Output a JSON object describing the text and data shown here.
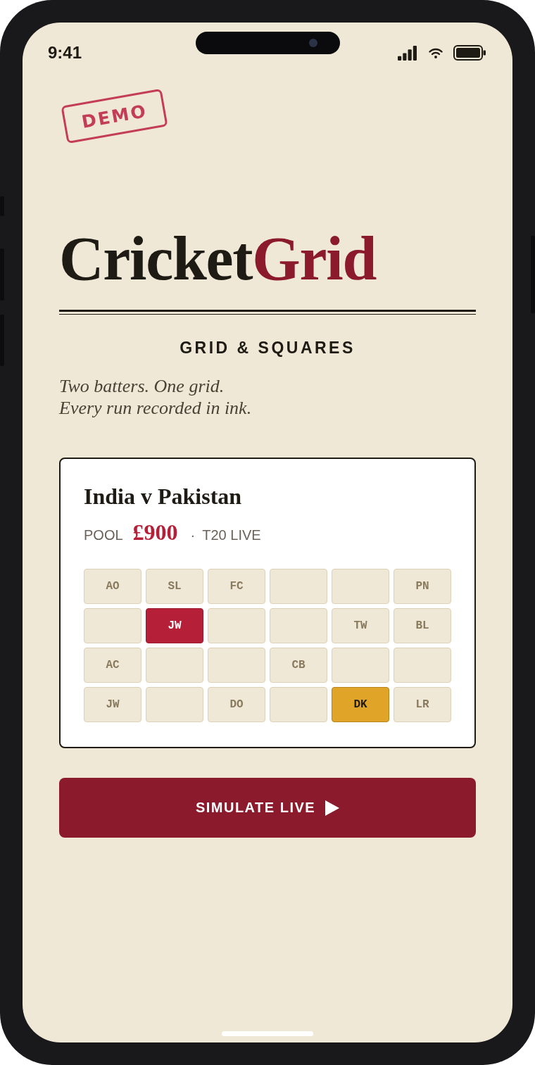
{
  "status_bar": {
    "time": "9:41"
  },
  "stamp": {
    "label": "DEMO"
  },
  "logo": [
    {
      "text": "Cricket",
      "accent": false
    },
    {
      "text": "Grid",
      "accent": true
    }
  ],
  "section_heading": "GRID & SQUARES",
  "tagline": [
    "Two batters. One grid.",
    "Every run recorded in ink."
  ],
  "match_card": {
    "title": "India v Pakistan",
    "pool_label": "POOL",
    "pool_amount": "£900",
    "separator": "·",
    "format": "T20 LIVE",
    "squares": [
      [
        {
          "initials": "AO",
          "selected": false,
          "leading": false
        },
        {
          "initials": "SL",
          "selected": false,
          "leading": false
        },
        {
          "initials": "FC",
          "selected": false,
          "leading": false
        },
        {
          "selected": false,
          "leading": false
        },
        {
          "selected": false,
          "leading": false
        },
        {
          "initials": "PN",
          "selected": false,
          "leading": false
        }
      ],
      [
        {
          "selected": false,
          "leading": false
        },
        {
          "initials": "JW",
          "selected": true,
          "leading": false
        },
        {
          "selected": false,
          "leading": false
        },
        {
          "selected": false,
          "leading": false
        },
        {
          "initials": "TW",
          "selected": false,
          "leading": false
        },
        {
          "initials": "BL",
          "selected": false,
          "leading": false
        }
      ],
      [
        {
          "initials": "AC",
          "selected": false,
          "leading": false
        },
        {
          "selected": false,
          "leading": false
        },
        {
          "selected": false,
          "leading": false
        },
        {
          "initials": "CB",
          "selected": false,
          "leading": false
        },
        {
          "selected": false,
          "leading": false
        },
        {
          "selected": false,
          "leading": false
        }
      ],
      [
        {
          "initials": "JW",
          "selected": false,
          "leading": false
        },
        {
          "selected": false,
          "leading": false
        },
        {
          "initials": "DO",
          "selected": false,
          "leading": false
        },
        {
          "selected": false,
          "leading": false
        },
        {
          "initials": "DK",
          "selected": false,
          "leading": true
        },
        {
          "initials": "LR",
          "selected": false,
          "leading": false
        }
      ]
    ]
  },
  "primary_button": {
    "label": "SIMULATE LIVE"
  }
}
